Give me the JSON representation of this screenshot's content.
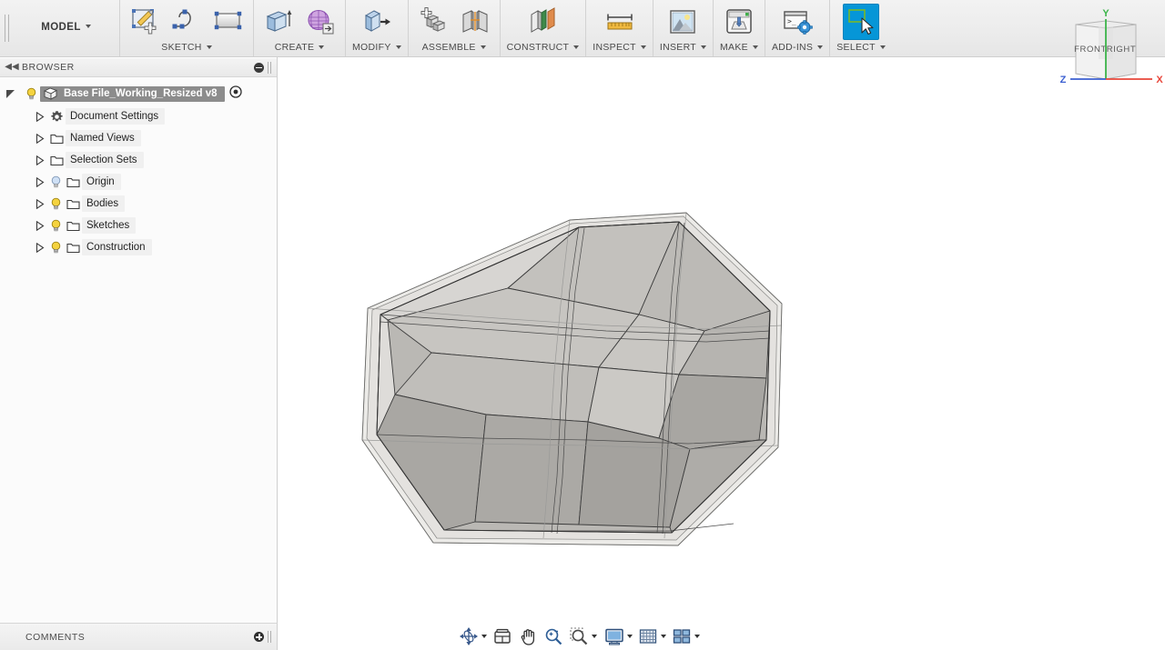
{
  "app": {
    "workspace_label": "MODEL"
  },
  "toolbar": {
    "groups": [
      {
        "name": "sketch",
        "label": "SKETCH",
        "icons": [
          "create-sketch-icon",
          "spline-icon",
          "rectangle-icon"
        ]
      },
      {
        "name": "create",
        "label": "CREATE",
        "icons": [
          "extrude-icon",
          "mesh-icon"
        ]
      },
      {
        "name": "modify",
        "label": "MODIFY",
        "icons": [
          "press-pull-icon"
        ]
      },
      {
        "name": "assemble",
        "label": "ASSEMBLE",
        "icons": [
          "new-component-icon",
          "joint-icon"
        ]
      },
      {
        "name": "construct",
        "label": "CONSTRUCT",
        "icons": [
          "offset-plane-icon"
        ]
      },
      {
        "name": "inspect",
        "label": "INSPECT",
        "icons": [
          "measure-icon"
        ]
      },
      {
        "name": "insert",
        "label": "INSERT",
        "icons": [
          "insert-image-icon"
        ]
      },
      {
        "name": "make",
        "label": "MAKE",
        "icons": [
          "3d-print-icon"
        ]
      },
      {
        "name": "addins",
        "label": "ADD-INS",
        "icons": [
          "scripts-addins-icon"
        ]
      },
      {
        "name": "select",
        "label": "SELECT",
        "icons": [
          "select-window-icon"
        ],
        "selected": true
      }
    ]
  },
  "browser": {
    "title": "BROWSER",
    "collapse_icon": "collapse-left-icon",
    "minimize_icon": "minus-circle-icon",
    "root": {
      "label": "Base File_Working_Resized v8",
      "icon": "component-icon",
      "target_icon": "activate-component-icon",
      "expanded": true,
      "visible": true
    },
    "items": [
      {
        "label": "Document Settings",
        "icon": "gear-icon",
        "has_bulb": false,
        "bulb_on": false
      },
      {
        "label": "Named Views",
        "icon": "folder-icon",
        "has_bulb": false,
        "bulb_on": false
      },
      {
        "label": "Selection Sets",
        "icon": "folder-icon",
        "has_bulb": false,
        "bulb_on": false
      },
      {
        "label": "Origin",
        "icon": "folder-icon",
        "has_bulb": true,
        "bulb_on": false
      },
      {
        "label": "Bodies",
        "icon": "folder-icon",
        "has_bulb": true,
        "bulb_on": true
      },
      {
        "label": "Sketches",
        "icon": "folder-icon",
        "has_bulb": true,
        "bulb_on": true
      },
      {
        "label": "Construction",
        "icon": "folder-icon",
        "has_bulb": true,
        "bulb_on": true
      }
    ]
  },
  "comments": {
    "label": "COMMENTS",
    "add_icon": "plus-circle-icon"
  },
  "viewcube": {
    "front_label": "FRONT",
    "right_label": "RIGHT",
    "axes": [
      {
        "name": "Y",
        "label": "Y",
        "color": "#3cb54a"
      },
      {
        "name": "X",
        "label": "X",
        "color": "#e8463a"
      },
      {
        "name": "Z",
        "label": "Z",
        "color": "#3b5fd1"
      }
    ]
  },
  "navbar": {
    "items": [
      {
        "name": "orbit-icon",
        "label": "Orbit",
        "dropdown": true
      },
      {
        "name": "look-at-icon",
        "label": "Look At",
        "dropdown": false
      },
      {
        "name": "pan-icon",
        "label": "Pan",
        "dropdown": false
      },
      {
        "name": "zoom-icon",
        "label": "Zoom",
        "dropdown": false
      },
      {
        "name": "zoom-window-icon",
        "label": "Zoom Window",
        "dropdown": true
      },
      {
        "name": "display-settings-icon",
        "label": "Display Settings",
        "dropdown": true
      },
      {
        "name": "grid-snaps-icon",
        "label": "Grid and Snaps",
        "dropdown": true
      },
      {
        "name": "viewports-icon",
        "label": "Viewports",
        "dropdown": true
      }
    ]
  },
  "model": {
    "name": "polyhedral-solid-body",
    "colors": {
      "shell": "#e8e8e6",
      "face_light": "#c8c6c2",
      "face_mid": "#b7b5b1",
      "face_dark": "#a3a19d",
      "face_darker": "#9a9894",
      "edge": "#3c3c3c"
    }
  }
}
